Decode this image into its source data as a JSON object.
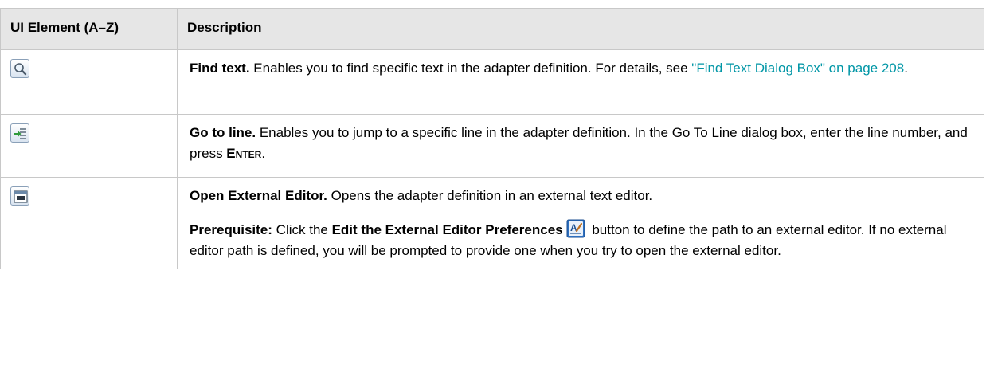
{
  "table": {
    "headers": {
      "col1": "UI Element (A–Z)",
      "col2": "Description"
    },
    "rows": [
      {
        "icon": "search-icon",
        "term": "Find text.",
        "text": " Enables you to find specific text in the adapter definition. For details, see ",
        "link": "\"Find Text Dialog Box\" on page 208",
        "tail": "."
      },
      {
        "icon": "go-to-line-icon",
        "term": "Go to line.",
        "text": " Enables you to jump to a specific line in the adapter definition. In the Go To Line dialog box, enter the line number, and press ",
        "key": "Enter",
        "tail": "."
      },
      {
        "icon": "external-editor-icon",
        "term": "Open External Editor.",
        "text": " Opens the adapter definition in an external text editor.",
        "prereq_label": "Prerequisite:",
        "prereq_text1": " Click the ",
        "prereq_bold": "Edit the External Editor Preferences",
        "prereq_icon": "editor-preferences-icon",
        "prereq_text2": " button to define the path to an external editor. If no external editor path is defined, you will be prompted to provide one when you try to open the external editor."
      }
    ]
  },
  "colors": {
    "header_bg": "#e6e6e6",
    "border": "#c8c8c8",
    "link": "#0096a6"
  }
}
